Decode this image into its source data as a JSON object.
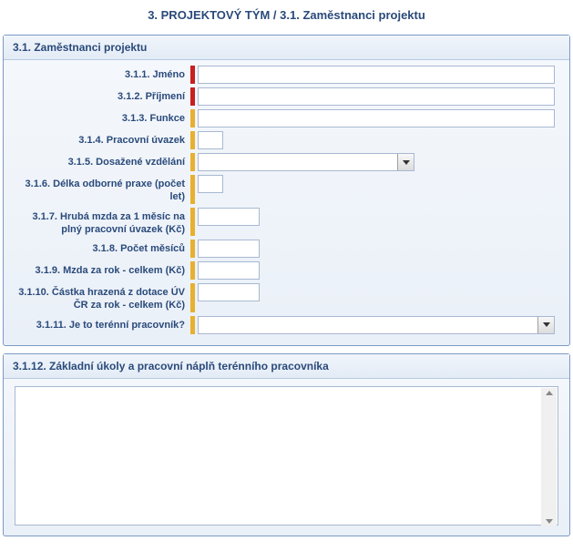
{
  "page": {
    "title": "3. PROJEKTOVÝ TÝM / 3.1. Zaměstnanci projektu"
  },
  "section1": {
    "header": "3.1. Zaměstnanci projektu",
    "fields": {
      "jmeno": {
        "label": "3.1.1. Jméno",
        "value": ""
      },
      "prijmeni": {
        "label": "3.1.2. Příjmení",
        "value": ""
      },
      "funkce": {
        "label": "3.1.3. Funkce",
        "value": ""
      },
      "uvazek": {
        "label": "3.1.4. Pracovní úvazek",
        "value": ""
      },
      "vzdelani": {
        "label": "3.1.5. Dosažené vzdělání",
        "value": ""
      },
      "praxe": {
        "label": "3.1.6. Délka odborné praxe (počet let)",
        "value": ""
      },
      "mzda_mesic": {
        "label": "3.1.7. Hrubá mzda za 1 měsíc na plný pracovní úvazek (Kč)",
        "value": ""
      },
      "pocet_mesicu": {
        "label": "3.1.8. Počet měsíců",
        "value": ""
      },
      "mzda_rok": {
        "label": "3.1.9. Mzda za rok - celkem (Kč)",
        "value": ""
      },
      "castka_dotace": {
        "label": "3.1.10. Částka hrazená z dotace ÚV ČR za rok - celkem (Kč)",
        "value": ""
      },
      "terenni": {
        "label": "3.1.11. Je to terénní pracovník?",
        "value": ""
      }
    }
  },
  "section2": {
    "header": "3.1.12. Základní úkoly a pracovní náplň terénního pracovníka",
    "value": ""
  }
}
